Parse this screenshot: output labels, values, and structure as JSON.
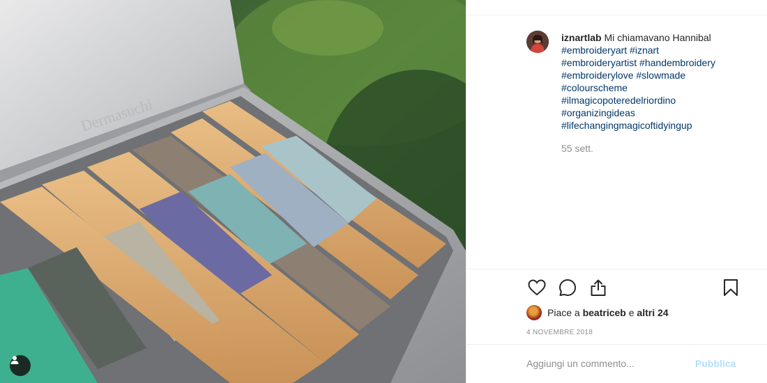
{
  "post": {
    "username": "iznartlab",
    "caption_text": "Mi chiamavano Hannibal",
    "hashtags": [
      "#embroideryart",
      "#iznart",
      "#embroideryartist",
      "#handembroidery",
      "#embroiderylove",
      "#slowmade",
      "#colourscheme",
      "#ilmagicopoteredelriordino",
      "#organizingideas",
      "#lifechangingmagicoftidyingup"
    ],
    "caption_time": "55 sett.",
    "likes": {
      "prefix": "Piace a",
      "user": "beatriceb",
      "conjunction": "e",
      "others": "altri 24"
    },
    "date": "4 NOVEMBRE 2018",
    "tin_embossed_text": "Dermasuchi"
  },
  "comment": {
    "placeholder": "Aggiungi un commento...",
    "publish_label": "Pubblica"
  },
  "icons": {
    "like": "heart-icon",
    "comment": "comment-icon",
    "share": "share-icon",
    "save": "bookmark-icon",
    "tag": "user-icon"
  },
  "colors": {
    "hashtag": "#00376b",
    "muted": "#8e8e8e",
    "publish_disabled": "#b2dffc",
    "divider": "#efefef"
  }
}
